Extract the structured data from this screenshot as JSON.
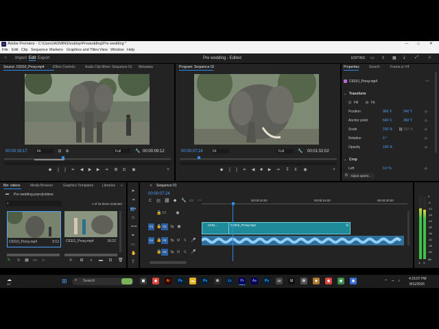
{
  "window": {
    "title": "Adobe Premiere - C:\\Users\\ADMIN\\Desktop\\Prewedding\\Pre wedding *",
    "controls": [
      "—",
      "□",
      "✕"
    ]
  },
  "menu": [
    "File",
    "Edit",
    "Clip",
    "Sequence",
    "Markers",
    "Graphics and Titles",
    "View",
    "Window",
    "Help"
  ],
  "header": {
    "modes": [
      "Import",
      "Edit",
      "Export"
    ],
    "active_mode": "Edit",
    "project_title": "Pre wedding - Edited",
    "workspace": "EDITING"
  },
  "source_panel": {
    "tabs": [
      "Source: C6310_Proxy.mp4",
      "Effect Controls",
      "Audio Clip Mixer: Sequence 01",
      "Metadata"
    ],
    "timecode": "00:00:19:17",
    "fit": "Fit",
    "quality": "Full",
    "duration": "00:00:09:12"
  },
  "program_panel": {
    "tabs": [
      "Program: Sequence 01"
    ],
    "timecode": "00:00:07:24",
    "fit": "Fit",
    "quality": "Full",
    "duration": "00:01:02:02"
  },
  "properties": {
    "tabs": [
      "Properties",
      "Search",
      "Frame.io V4"
    ],
    "clip": "C6310_Proxy.mp4",
    "transform_label": "Transform",
    "fill_fit": [
      "Fill",
      "Fit"
    ],
    "rows": [
      {
        "label": "Position",
        "v1": "960 X",
        "v2": "540 Y"
      },
      {
        "label": "Anchor point",
        "v1": "640 X",
        "v2": "360 Y"
      },
      {
        "label": "Scale",
        "v1": "150 %",
        "v2": "150 %"
      },
      {
        "label": "Rotation",
        "v1": "0 °",
        "v2": ""
      },
      {
        "label": "Opacity",
        "v1": "100 %",
        "v2": ""
      }
    ],
    "crop_label": "Crop",
    "crop_row": {
      "label": "Left",
      "v1": "0.0 %"
    },
    "adjust_speed": "Adjust speed..."
  },
  "project_panel": {
    "tabs": [
      "Bin: videos",
      "Media Browser",
      "Graphics Templates",
      "Libraries"
    ],
    "path": "Pre wedding.prproj\\videos",
    "count": "1 of 34 items selected",
    "items": [
      {
        "name": "C6310_Proxy.mp4",
        "duration": "9:12"
      },
      {
        "name": "C6311_Proxy.mp4",
        "duration": "16:22"
      }
    ]
  },
  "timeline": {
    "tab": "Sequence 01",
    "timecode": "00:00:07:24",
    "ruler": [
      "00:00:10:00",
      "00:00:15:00",
      "00:00:20:00"
    ],
    "tracks": [
      "V1",
      "A1",
      "A2"
    ],
    "clips": [
      {
        "label": "C631..."
      },
      {
        "label": "C6310_Proxy.mp4"
      }
    ]
  },
  "meter_labels": [
    "0",
    "-6",
    "-12",
    "-18",
    "-24",
    "-30",
    "-36",
    "-42",
    "-48",
    "-54",
    "dB"
  ],
  "taskbar": {
    "search_placeholder": "Search",
    "time": "4:15:07 PM",
    "date": "8/11/2026",
    "weather": "28°"
  },
  "colors": {
    "accent": "#2d8ceb",
    "clip_teal": "#1f8a9a",
    "audio_blue": "#3a7ea8",
    "panel_bg": "#232323",
    "meter_green": "#3ec24a"
  }
}
